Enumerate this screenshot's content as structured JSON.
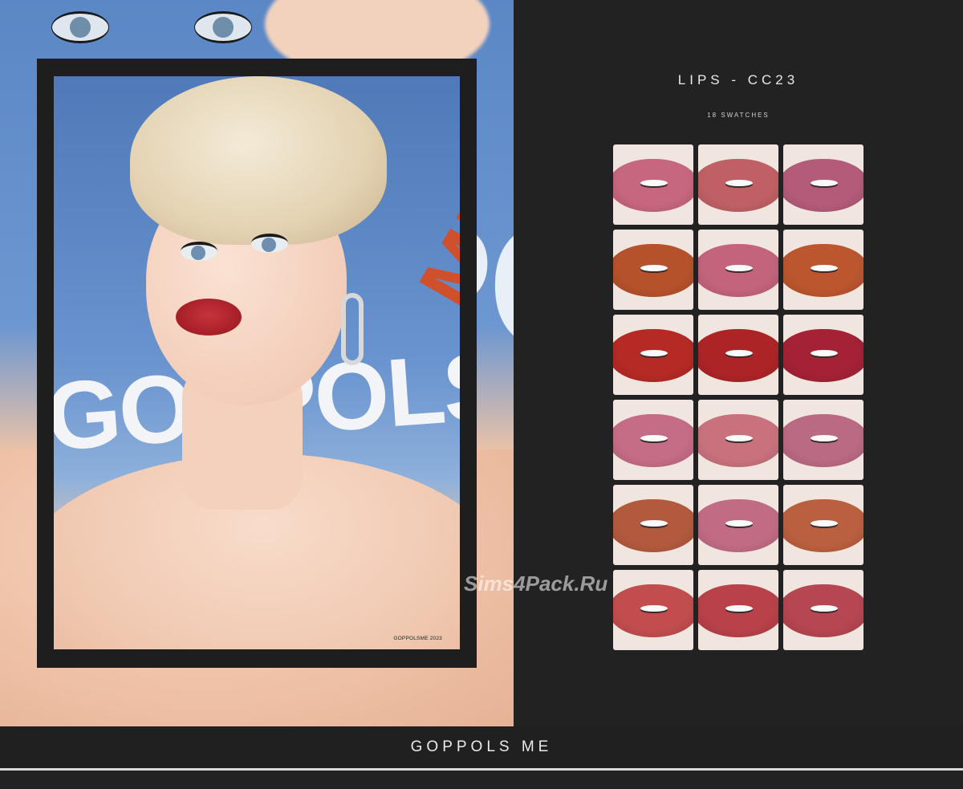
{
  "header": {
    "title": "LIPS - CC23",
    "subtitle": "18 SWATCHES"
  },
  "poster": {
    "backdrop_text": "GOPPOLSME",
    "photo_text": "GOPPOLSME",
    "caption": "GOPPOLSME 2023"
  },
  "swatches": {
    "colors": [
      [
        "#c7667f",
        "#c06064",
        "#b45b79"
      ],
      [
        "#b5522c",
        "#c4637c",
        "#bb562f"
      ],
      [
        "#b52a25",
        "#ad2427",
        "#a52135"
      ],
      [
        "#c56c86",
        "#c9727e",
        "#bb6a83"
      ],
      [
        "#b35a3e",
        "#c16c84",
        "#bb603e"
      ],
      [
        "#c24d4f",
        "#b9414a",
        "#b64651"
      ]
    ]
  },
  "watermark": "Sims4Pack.Ru",
  "footer": {
    "brand": "GOPPOLS ME"
  }
}
